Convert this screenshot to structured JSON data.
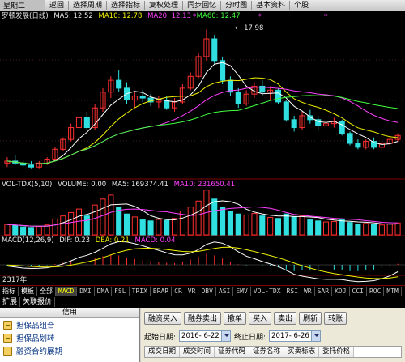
{
  "toolbar": {
    "logo": "星期二",
    "items": [
      "返回",
      "选择周期",
      "选择指标",
      "复权处理",
      "同步回忆",
      "分时图",
      "基本资料",
      "个股"
    ]
  },
  "chart_header": {
    "stock_title": "罗顿发展(日线)",
    "ma5": "MA5: 12.52",
    "ma10": "MA10: 12.78",
    "ma20": "MA20: 12.13",
    "ma60": "MA60: 12.47",
    "peak_label": "17.98"
  },
  "volume_header": {
    "name": "VOL-TDX(5,10)",
    "vol": "VOLUME: 0.00",
    "ma5": "MA5: 169374.41",
    "ma10": "MA10: 231650.41"
  },
  "macd_header": {
    "name": "MACD(12,26,9)",
    "dif": "DIF: 0.23",
    "dea": "DEA: 0.21",
    "macd": "MACD: 0.04"
  },
  "axis_label": "2317年",
  "index_tabs": {
    "label_zhibiao": "指标",
    "label_template": "模板",
    "label_all": "全部",
    "tabs": [
      "MACD",
      "DMI",
      "DMA",
      "FSL",
      "TRIX",
      "BRAR",
      "CR",
      "VR",
      "OBV",
      "ASI",
      "EMV",
      "VOL-TDX",
      "RSI",
      "WR",
      "SAR",
      "KDJ",
      "CCI",
      "ROC",
      "MTM"
    ]
  },
  "sub_tabs": [
    "扩展",
    "关联报价"
  ],
  "info_panel": {
    "title": "信用",
    "items": [
      "担保品组合",
      "担保品划转",
      "融资合约展期"
    ]
  },
  "trade_panel": {
    "buttons": [
      "融资买入",
      "融券卖出",
      "撤单",
      "买入",
      "卖出",
      "刷新",
      "转账"
    ],
    "start_label": "起始日期:",
    "start_value": "2016- 6-22",
    "end_label": "终止日期:",
    "end_value": "2017- 6-26",
    "columns": [
      "成交日期",
      "成交时间",
      "证券代码",
      "证券名称",
      "买卖标志",
      "委托价格"
    ]
  },
  "chart_data": {
    "type": "candlestick",
    "colors": {
      "up": "#ff3030",
      "down": "#30e0e0",
      "ma5": "#ffffff",
      "ma10": "#f0f000",
      "ma20": "#ff40ff",
      "ma60": "#40ff40"
    },
    "candles": [
      [
        11.2,
        11.5,
        11.0,
        11.3
      ],
      [
        11.3,
        11.6,
        11.1,
        11.2
      ],
      [
        11.2,
        11.4,
        11.0,
        11.1
      ],
      [
        11.1,
        11.3,
        10.9,
        11.0
      ],
      [
        11.0,
        11.3,
        10.9,
        11.2
      ],
      [
        11.2,
        11.5,
        11.1,
        11.4
      ],
      [
        11.4,
        12.0,
        11.3,
        11.9
      ],
      [
        11.9,
        12.5,
        11.8,
        12.4
      ],
      [
        12.4,
        13.2,
        12.3,
        13.0
      ],
      [
        13.0,
        13.6,
        12.8,
        13.5
      ],
      [
        13.5,
        13.8,
        12.9,
        13.0
      ],
      [
        13.0,
        14.2,
        12.9,
        14.0
      ],
      [
        14.0,
        15.0,
        13.8,
        14.8
      ],
      [
        14.8,
        15.6,
        14.5,
        15.4
      ],
      [
        15.4,
        15.9,
        14.8,
        15.0
      ],
      [
        15.0,
        15.3,
        14.2,
        14.4
      ],
      [
        14.4,
        14.8,
        14.0,
        14.6
      ],
      [
        14.6,
        14.9,
        14.3,
        14.5
      ],
      [
        14.5,
        14.7,
        14.1,
        14.3
      ],
      [
        14.3,
        14.6,
        14.0,
        14.4
      ],
      [
        14.4,
        14.6,
        13.9,
        14.0
      ],
      [
        14.0,
        14.5,
        13.8,
        14.3
      ],
      [
        14.3,
        15.2,
        14.2,
        15.0
      ],
      [
        15.0,
        15.8,
        14.9,
        15.6
      ],
      [
        15.6,
        16.8,
        15.5,
        16.6
      ],
      [
        16.6,
        17.98,
        16.4,
        17.5
      ],
      [
        17.5,
        17.7,
        16.2,
        16.4
      ],
      [
        16.4,
        16.6,
        15.2,
        15.4
      ],
      [
        15.4,
        15.6,
        14.6,
        14.8
      ],
      [
        14.8,
        15.0,
        14.0,
        14.2
      ],
      [
        14.2,
        14.9,
        14.1,
        14.7
      ],
      [
        14.7,
        15.3,
        14.5,
        15.1
      ],
      [
        15.1,
        15.4,
        14.6,
        14.8
      ],
      [
        14.8,
        15.1,
        14.4,
        14.9
      ],
      [
        14.9,
        15.0,
        14.2,
        14.3
      ],
      [
        14.3,
        14.4,
        13.3,
        13.4
      ],
      [
        13.4,
        13.6,
        12.8,
        13.0
      ],
      [
        13.0,
        13.8,
        12.9,
        13.6
      ],
      [
        13.6,
        13.9,
        13.2,
        13.4
      ],
      [
        13.4,
        13.6,
        12.9,
        13.1
      ],
      [
        13.1,
        13.4,
        12.8,
        13.2
      ],
      [
        13.2,
        13.5,
        13.0,
        13.3
      ],
      [
        13.3,
        13.4,
        12.6,
        12.7
      ],
      [
        12.7,
        12.8,
        12.1,
        12.2
      ],
      [
        12.2,
        12.4,
        11.9,
        12.0
      ],
      [
        12.0,
        12.4,
        11.9,
        12.3
      ],
      [
        12.3,
        12.5,
        11.9,
        12.0
      ],
      [
        12.0,
        12.3,
        11.8,
        12.2
      ],
      [
        12.2,
        12.5,
        12.1,
        12.4
      ],
      [
        12.4,
        12.7,
        12.3,
        12.6
      ]
    ],
    "volume": [
      210,
      190,
      160,
      150,
      170,
      200,
      320,
      380,
      450,
      520,
      380,
      600,
      720,
      800,
      560,
      420,
      360,
      300,
      280,
      310,
      290,
      330,
      480,
      560,
      680,
      900,
      720,
      560,
      480,
      420,
      400,
      430,
      380,
      350,
      330,
      420,
      360,
      380,
      300,
      280,
      260,
      270,
      300,
      250,
      220,
      230,
      210,
      200,
      220,
      240
    ],
    "macd_hist": [
      -0.05,
      -0.06,
      -0.07,
      -0.06,
      -0.04,
      -0.02,
      0.03,
      0.08,
      0.14,
      0.2,
      0.18,
      0.25,
      0.33,
      0.4,
      0.36,
      0.28,
      0.22,
      0.18,
      0.14,
      0.12,
      0.08,
      0.07,
      0.12,
      0.2,
      0.3,
      0.42,
      0.36,
      0.24,
      0.12,
      0.02,
      -0.02,
      0.0,
      -0.04,
      -0.06,
      -0.1,
      -0.18,
      -0.24,
      -0.2,
      -0.2,
      -0.22,
      -0.2,
      -0.18,
      -0.2,
      -0.24,
      -0.24,
      -0.2,
      -0.18,
      -0.12,
      -0.06,
      0.04
    ]
  }
}
